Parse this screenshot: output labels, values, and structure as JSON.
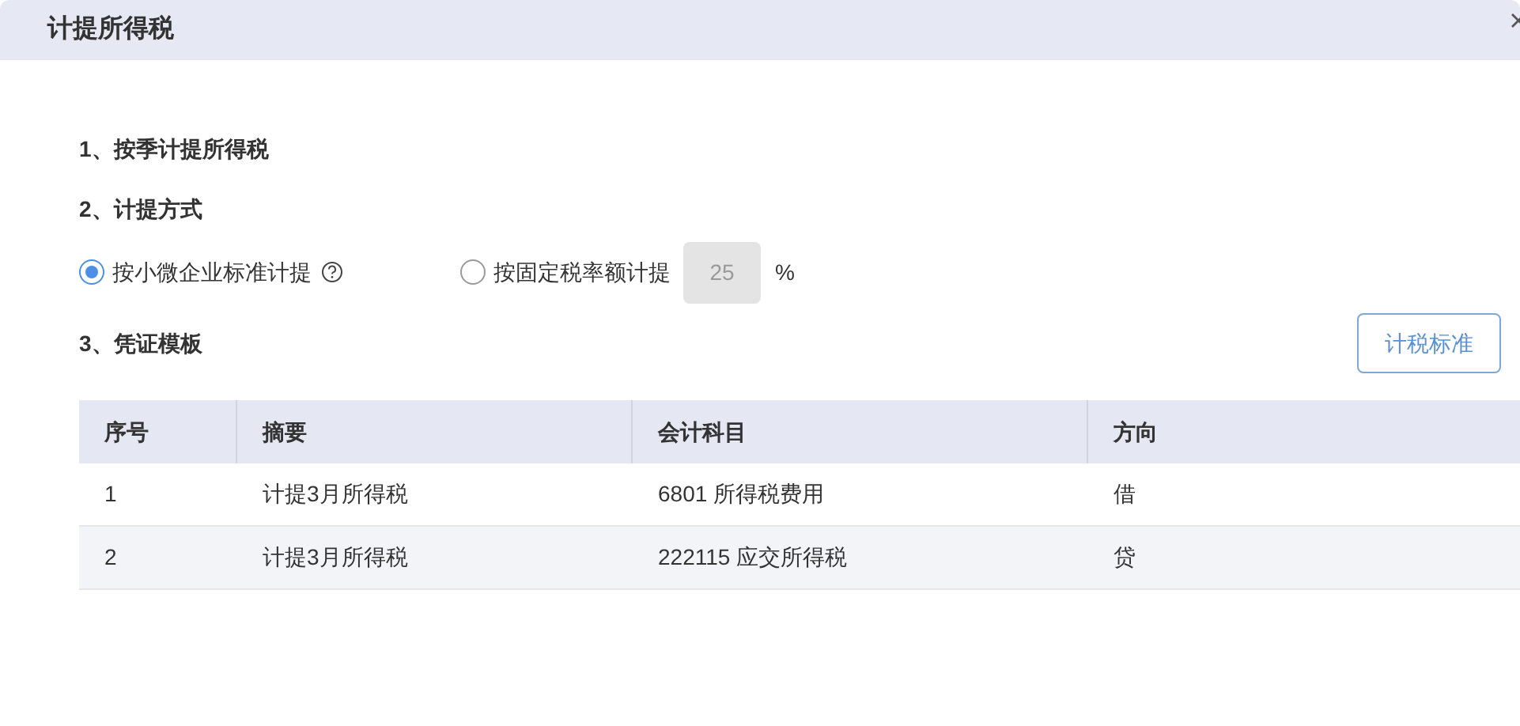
{
  "dialog": {
    "title": "计提所得税"
  },
  "sections": [
    {
      "kind": "heading",
      "label": "1、按季计提所得税"
    },
    {
      "kind": "heading",
      "label": "2、计提方式"
    },
    {
      "kind": "methods",
      "options": [
        {
          "label": "按小微企业标准计提",
          "selected": true,
          "help": true
        },
        {
          "label": "按固定税率额计提",
          "selected": false,
          "rate": {
            "value": "25",
            "disabled": true,
            "unit": "%"
          }
        }
      ]
    },
    {
      "kind": "heading",
      "label": "3、凭证模板",
      "button": "计税标准"
    }
  ],
  "table": {
    "columns": [
      "序号",
      "摘要",
      "会计科目",
      "方向"
    ],
    "rows": [
      [
        "1",
        "计提3月所得税",
        "6801 所得税费用",
        "借"
      ],
      [
        "2",
        "计提3月所得税",
        "222115 应交所得税",
        "贷"
      ]
    ]
  }
}
